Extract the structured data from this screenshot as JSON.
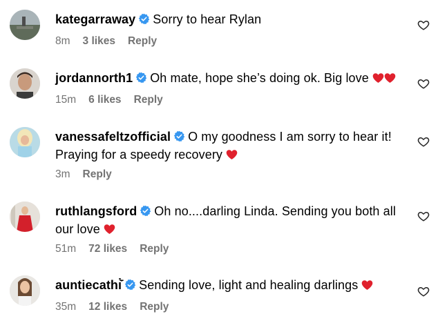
{
  "colors": {
    "verified": "#3797f0",
    "heart_emoji": "#e0212d",
    "meta_text": "#737373"
  },
  "comments": [
    {
      "username": "kategarraway",
      "verified": true,
      "text": "Sorry to hear Rylan",
      "emoji": "",
      "time": "8m",
      "likes": "3 likes",
      "reply": "Reply"
    },
    {
      "username": "jordannorth1",
      "verified": true,
      "text": "Oh mate, hope she’s doing ok. Big love",
      "emoji": "red-heart-x2",
      "time": "15m",
      "likes": "6 likes",
      "reply": "Reply"
    },
    {
      "username": "vanessafeltzofficial",
      "verified": true,
      "text": "O my goodness I am sorry to hear it! Praying for a speedy recovery",
      "emoji": "red-heart",
      "time": "3m",
      "likes": "",
      "reply": "Reply"
    },
    {
      "username": "ruthlangsford",
      "verified": true,
      "text": "Oh no....darling Linda. Sending you both all our love",
      "emoji": "red-heart",
      "time": "51m",
      "likes": "72 likes",
      "reply": "Reply"
    },
    {
      "username": "auntiecathı̇̄̇",
      "verified": true,
      "text": "Sending love, light and healing darlings",
      "emoji": "red-heart",
      "time": "35m",
      "likes": "12 likes",
      "reply": "Reply"
    }
  ]
}
